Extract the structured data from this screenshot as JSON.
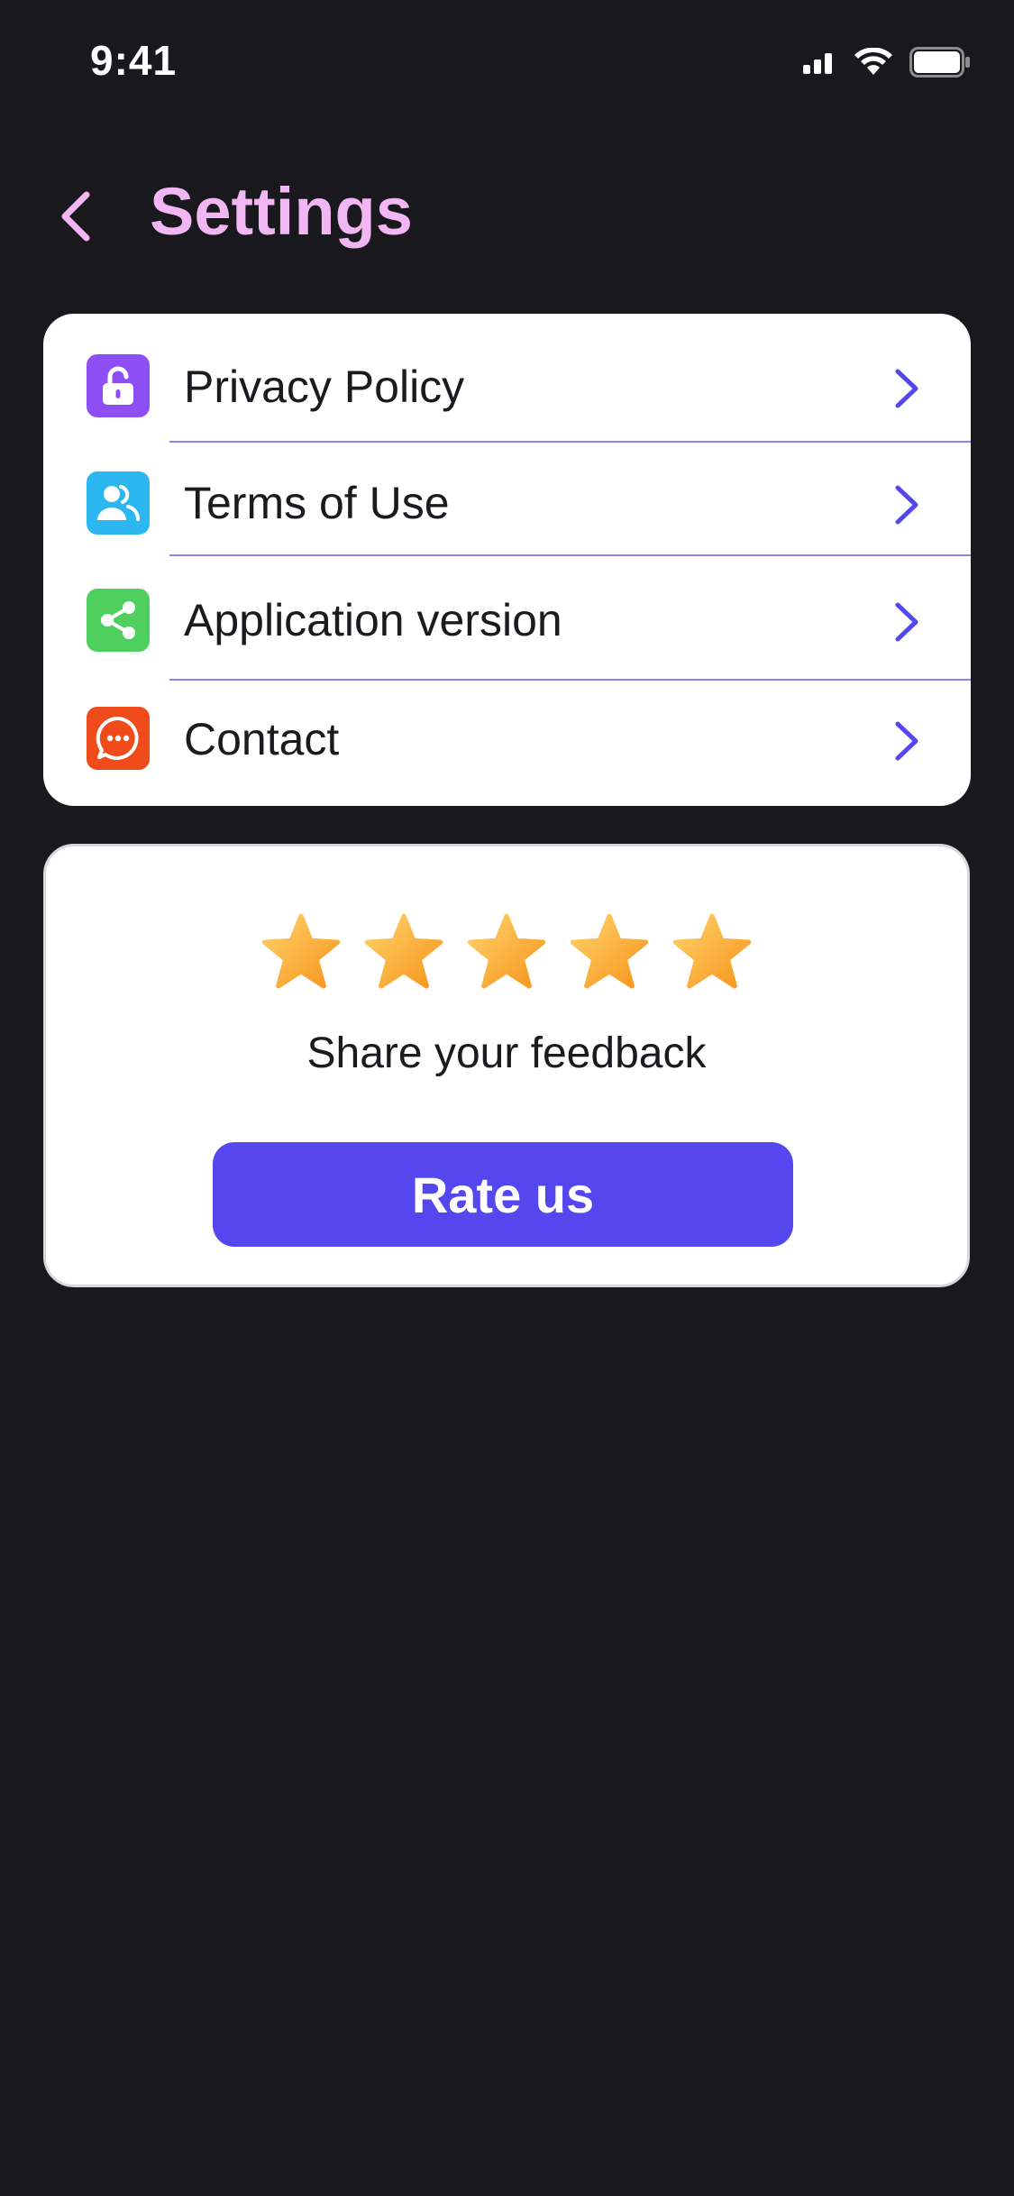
{
  "status_bar": {
    "time": "9:41",
    "icons": [
      "cellular-signal-icon",
      "wifi-icon",
      "battery-icon"
    ]
  },
  "header": {
    "back_icon": "chevron-left-icon",
    "title": "Settings",
    "title_color": "#f2b6f4"
  },
  "menu": {
    "items": [
      {
        "label": "Privacy Policy",
        "icon": "lock-open-icon",
        "color": "#8d4ff3"
      },
      {
        "label": "Terms of Use",
        "icon": "users-icon",
        "color": "#2cb7f0"
      },
      {
        "label": "Application version",
        "icon": "share-icon",
        "color": "#4fd05e"
      },
      {
        "label": "Contact",
        "icon": "chat-bubble-icon",
        "color": "#f04b1a"
      }
    ],
    "chevron_icon": "chevron-right-icon",
    "chevron_color": "#5447ee"
  },
  "feedback": {
    "rating_stars": 5,
    "rating_max": 5,
    "prompt": "Share your feedback",
    "button_label": "Rate us",
    "button_color": "#5447ee"
  }
}
